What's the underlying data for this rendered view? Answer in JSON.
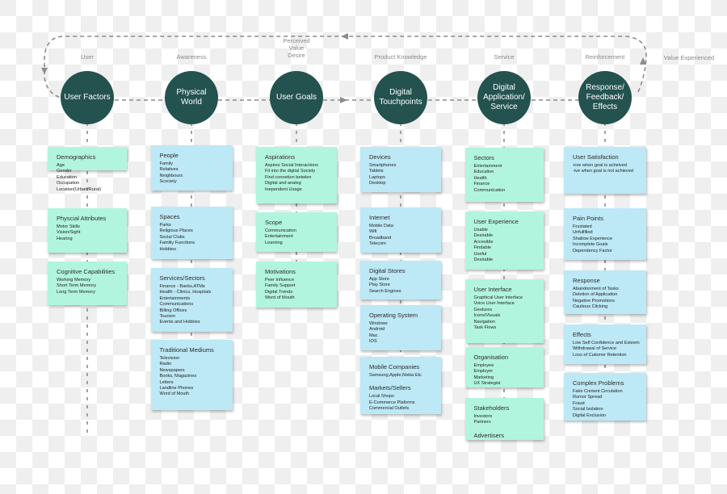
{
  "diagram": {
    "loop_labels": {
      "top_return": "Perceived Value Desire",
      "value_experienced": "Value\nExperienced"
    },
    "stages": [
      {
        "stage_label": "User",
        "node": "User Factors",
        "color": "#23524f",
        "cards": [
          {
            "title": "Demographics",
            "items": [
              "Age",
              "Gender",
              "Education",
              "Occupation",
              "Location(Urban/Rural)"
            ],
            "color": "#b2f5df"
          },
          {
            "title": "Physcial Attributes",
            "items": [
              "Motor Skills",
              "Vision/Sight",
              "Hearing"
            ],
            "color": "#b2f5df"
          },
          {
            "title": "Cognitive Capabilities",
            "items": [
              "Working Memory",
              "Short Term Memory",
              "Long Term Memory"
            ],
            "color": "#b2f5df"
          }
        ]
      },
      {
        "stage_label": "Awareness",
        "node": "Physical\nWorld",
        "color": "#23524f",
        "cards": [
          {
            "title": "People",
            "items": [
              "Family",
              "Relatives",
              "Neighbours",
              "Scociety"
            ],
            "color": "#bde8f5"
          },
          {
            "title": "Spaces",
            "items": [
              "Parks",
              "Religious Places",
              "Social Clubs",
              "Familiy Functions",
              "Hobbies"
            ],
            "color": "#bde8f5"
          },
          {
            "title": "Services/Sectors",
            "items": [
              "Finance - Banks,ATMs",
              "Health - Clinics, Hospitals",
              "Entertainments",
              "Communications",
              "Billing Offices",
              "Tourism",
              "Events and Hobbies"
            ],
            "color": "#bde8f5"
          },
          {
            "title": "Traditional Mediums",
            "items": [
              "Television",
              "Radio",
              "Newspapers",
              "Books, Magazines",
              "Letters",
              "Landline Phones",
              "Word of Mouth"
            ],
            "color": "#bde8f5"
          }
        ]
      },
      {
        "stage_label": "Perceived\nValue\nDesire",
        "node": "User Goals",
        "color": "#23524f",
        "cards": [
          {
            "title": "Aspirations",
            "items": [
              "Aspires Social Interactions",
              "Fit into the digital Society",
              "Find connetion betwlen",
              "Digital and analog",
              "Inependent Usage"
            ],
            "color": "#b2f5df"
          },
          {
            "title": "Scope",
            "items": [
              "Communication",
              "Entertainment",
              "Learning"
            ],
            "color": "#b2f5df"
          },
          {
            "title": "Motivations",
            "items": [
              "Peer Influence",
              "Family Support",
              "Digital Trends",
              "Word of Mouth"
            ],
            "color": "#b2f5df"
          }
        ]
      },
      {
        "stage_label": "Product Knowledge",
        "node": "Digital\nTouchpoints",
        "color": "#23524f",
        "cards": [
          {
            "title": "Devices",
            "items": [
              "Smartphones",
              "Tablets",
              "Laptops",
              "Desktop"
            ],
            "color": "#bde8f5"
          },
          {
            "title": "Internet",
            "items": [
              "Mobile Data",
              "Wifi",
              "Broadband",
              "Telecom"
            ],
            "color": "#bde8f5"
          },
          {
            "title": "Digital Stores",
            "items": [
              "App Store",
              "Play Store",
              "Search Engines"
            ],
            "color": "#bde8f5"
          },
          {
            "title": "Operating System",
            "items": [
              "Windows",
              "Android",
              "Mac",
              "IOS"
            ],
            "color": "#bde8f5"
          },
          {
            "title": "Mobile Companies",
            "items": [
              "Samsung,Apple,Nokia Etc"
            ],
            "title2": "Markets/Sellers",
            "items2": [
              "Local Shops",
              "E-Commerce Plaforms",
              "Commercial Outlets"
            ],
            "color": "#bde8f5"
          }
        ]
      },
      {
        "stage_label": "Service",
        "node": "Digital\nApplication/\nService",
        "color": "#23524f",
        "cards": [
          {
            "title": "Sectors",
            "items": [
              "Entertainment",
              "Education",
              "Health",
              "Finance",
              "Communication"
            ],
            "color": "#b2f5df"
          },
          {
            "title": "User Experience",
            "items": [
              "Usable",
              "Desirable",
              "Accesible",
              "Findable",
              "Useful",
              "Desirable"
            ],
            "color": "#b2f5df"
          },
          {
            "title": "User Interface",
            "items": [
              "Graphical User Interface",
              "Voice User Interface",
              "Gestures",
              "Icons/Visuals",
              "Navigation",
              "Task Flows"
            ],
            "color": "#b2f5df"
          },
          {
            "title": "Organisation",
            "items": [
              "Employee",
              "Employer",
              "Marketing",
              "UX Strategist"
            ],
            "color": "#b2f5df"
          },
          {
            "title": "Stakeholders",
            "items": [
              "Investors",
              "Partners"
            ],
            "title2": "Advertisers",
            "items2": [],
            "color": "#b2f5df"
          }
        ]
      },
      {
        "stage_label": "Reinforcement",
        "node": "Response/\nFeedback/\nEffects",
        "color": "#23524f",
        "cards": [
          {
            "title": "User Satisfaction",
            "items": [
              "+ive when goal is acheived",
              "-ive when goal is not achieved"
            ],
            "color": "#bde8f5"
          },
          {
            "title": "Pain Points",
            "items": [
              "Frustated",
              "Unfulfilled",
              "Shallow Experience",
              "Incomplete Goals",
              "Dependency Factor"
            ],
            "color": "#bde8f5"
          },
          {
            "title": "Response",
            "items": [
              "Abandonment of Tasks",
              "Deletion of Application",
              "Negative Promotions",
              "Cautious Clicking"
            ],
            "color": "#bde8f5"
          },
          {
            "title": "Effects",
            "items": [
              "Low Self Confidence and Esteem",
              "Withdrawal of Service",
              "Loss of Cutomer Retention"
            ],
            "color": "#bde8f5"
          },
          {
            "title": "Complex Problems",
            "items": [
              "Fake Content Circulation",
              "Rumor Spread",
              "Fraud",
              "Social Isolation",
              "Digital Exclusion"
            ],
            "color": "#bde8f5"
          }
        ]
      }
    ]
  }
}
